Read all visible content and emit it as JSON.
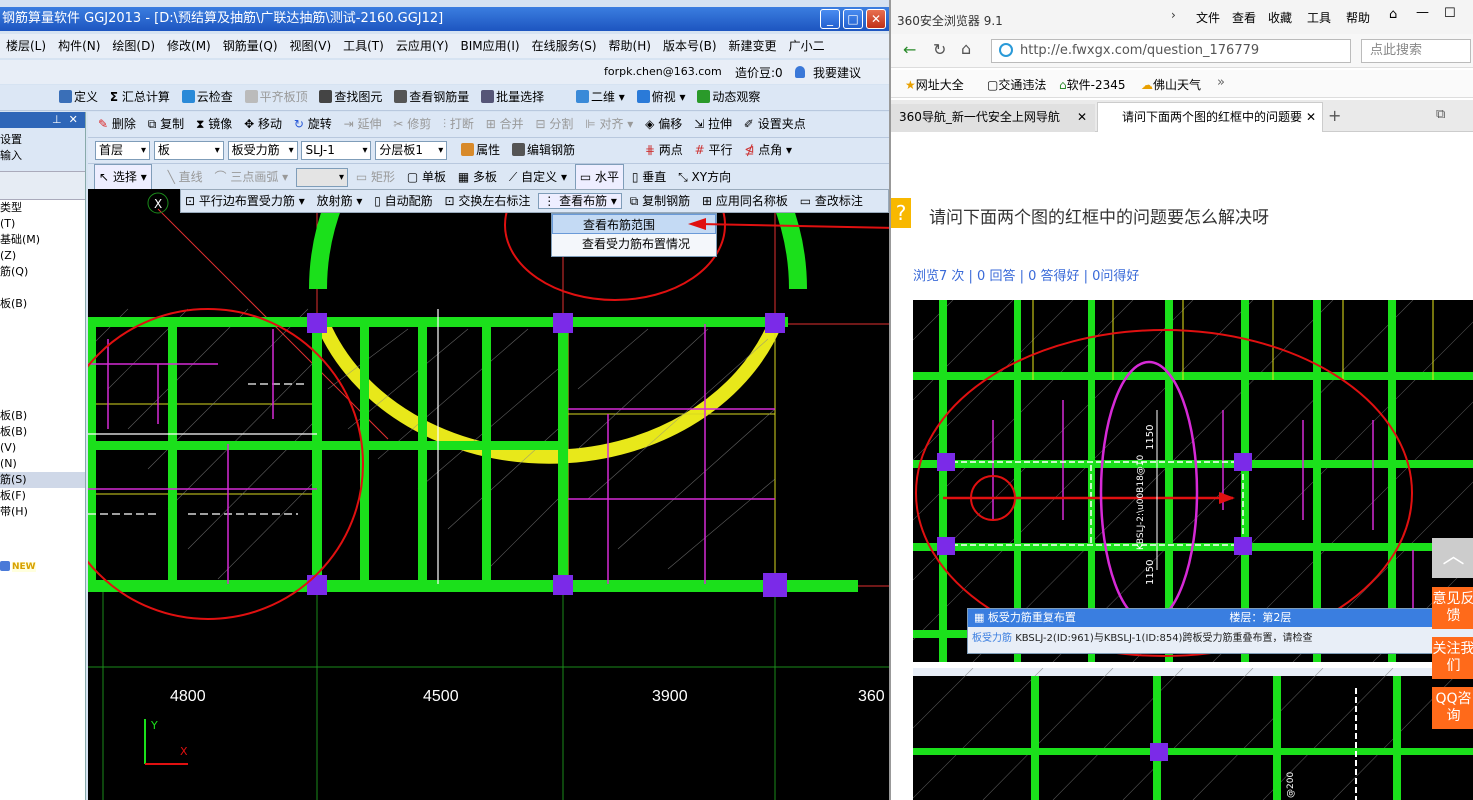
{
  "app": {
    "title": "钢筋算量软件 GGJ2013 - [D:\\预结算及抽筋\\广联达抽筋\\测试-2160.GGJ12]",
    "menu": [
      "楼层(L)",
      "构件(N)",
      "绘图(D)",
      "修改(M)",
      "钢筋量(Q)",
      "视图(V)",
      "工具(T)",
      "云应用(Y)",
      "BIM应用(I)",
      "在线服务(S)",
      "帮助(H)",
      "版本号(B)",
      "新建变更",
      "广小二"
    ],
    "account": "forpk.chen@163.com",
    "price_bean": "造价豆:0",
    "feedback": "我要建议",
    "toolbar1": [
      "定义",
      "汇总计算",
      "云检查",
      "平齐板顶",
      "查找图元",
      "查看钢筋量",
      "批量选择",
      "二维",
      "俯视",
      "动态观察"
    ],
    "toolbar2": [
      "删除",
      "复制",
      "镜像",
      "移动",
      "旋转",
      "延伸",
      "修剪",
      "打断",
      "合并",
      "分割",
      "对齐",
      "偏移",
      "拉伸",
      "设置夹点"
    ],
    "selectors": {
      "floor": "首层",
      "type": "板",
      "sub": "板受力筋",
      "name": "SLJ-1",
      "layer": "分层板1"
    },
    "toolbar3": [
      "属性",
      "编辑钢筋",
      "两点",
      "平行",
      "点角"
    ],
    "toolbar4": [
      "选择",
      "直线",
      "三点画弧",
      "矩形",
      "单板",
      "多板",
      "自定义",
      "水平",
      "垂直",
      "XY方向"
    ],
    "toolbar5": [
      "平行边布置受力筋",
      "放射筋",
      "自动配筋",
      "交换左右标注",
      "查看布筋",
      "复制钢筋",
      "应用同名称板",
      "查改标注"
    ],
    "dropdown": [
      "查看布筋范围",
      "查看受力筋布置情况"
    ],
    "left_panel": {
      "title": "",
      "items": [
        "设置",
        "输入",
        "",
        "类型",
        "(T)",
        "基础(M)",
        "(Z)",
        "筋(Q)",
        "",
        "板(B)",
        "",
        "",
        "",
        "",
        "",
        "",
        "板(B)",
        "板(B)",
        "(V)",
        "(N)",
        "筋(S)",
        "板(F)",
        "带(H)"
      ],
      "new_badge": "NEW"
    },
    "dimensions": [
      "4800",
      "4500",
      "3900",
      "360"
    ],
    "axis_labels": {
      "x": "X",
      "y": "Y"
    },
    "grid_marker": "X"
  },
  "browser": {
    "name": "360安全浏览器 9.1",
    "menu": [
      "文件",
      "查看",
      "收藏",
      "工具",
      "帮助"
    ],
    "url": "http://e.fwxgx.com/question_176779",
    "search_placeholder": "点此搜索",
    "favorites": [
      "网址大全",
      "交通违法",
      "软件-2345",
      "佛山天气"
    ],
    "tabs": [
      "360导航_新一代安全上网导航",
      "请问下面两个图的红框中的问题要"
    ],
    "question_title": "请问下面两个图的红框中的问题要怎么解决呀",
    "stats": "浏览7 次 | 0 回答 | 0 答得好 | 0问得好",
    "embedded_notice": {
      "panel_title": "板受力筋重复布置",
      "floor": "楼层：第2层",
      "label": "板受力筋",
      "message": "KBSLJ-2(ID:961)与KBSLJ-1(ID:854)跨板受力筋重叠布置，请检查"
    },
    "embedded_dims": [
      "1150",
      "1150"
    ],
    "embedded_rebar_label": "KBSLJ-2:\\u00B18@10",
    "embedded_rebar_label2": "@200",
    "side_buttons": [
      "意见反馈",
      "关注我们",
      "QQ咨询"
    ]
  },
  "colors": {
    "beam_green": "#1be01b",
    "rebar_yellow": "#e8e81a",
    "magenta": "#d62ad6",
    "column_purple": "#7b2ae8",
    "annotation_red": "#e01010",
    "title_blue": "#1d55c0"
  }
}
